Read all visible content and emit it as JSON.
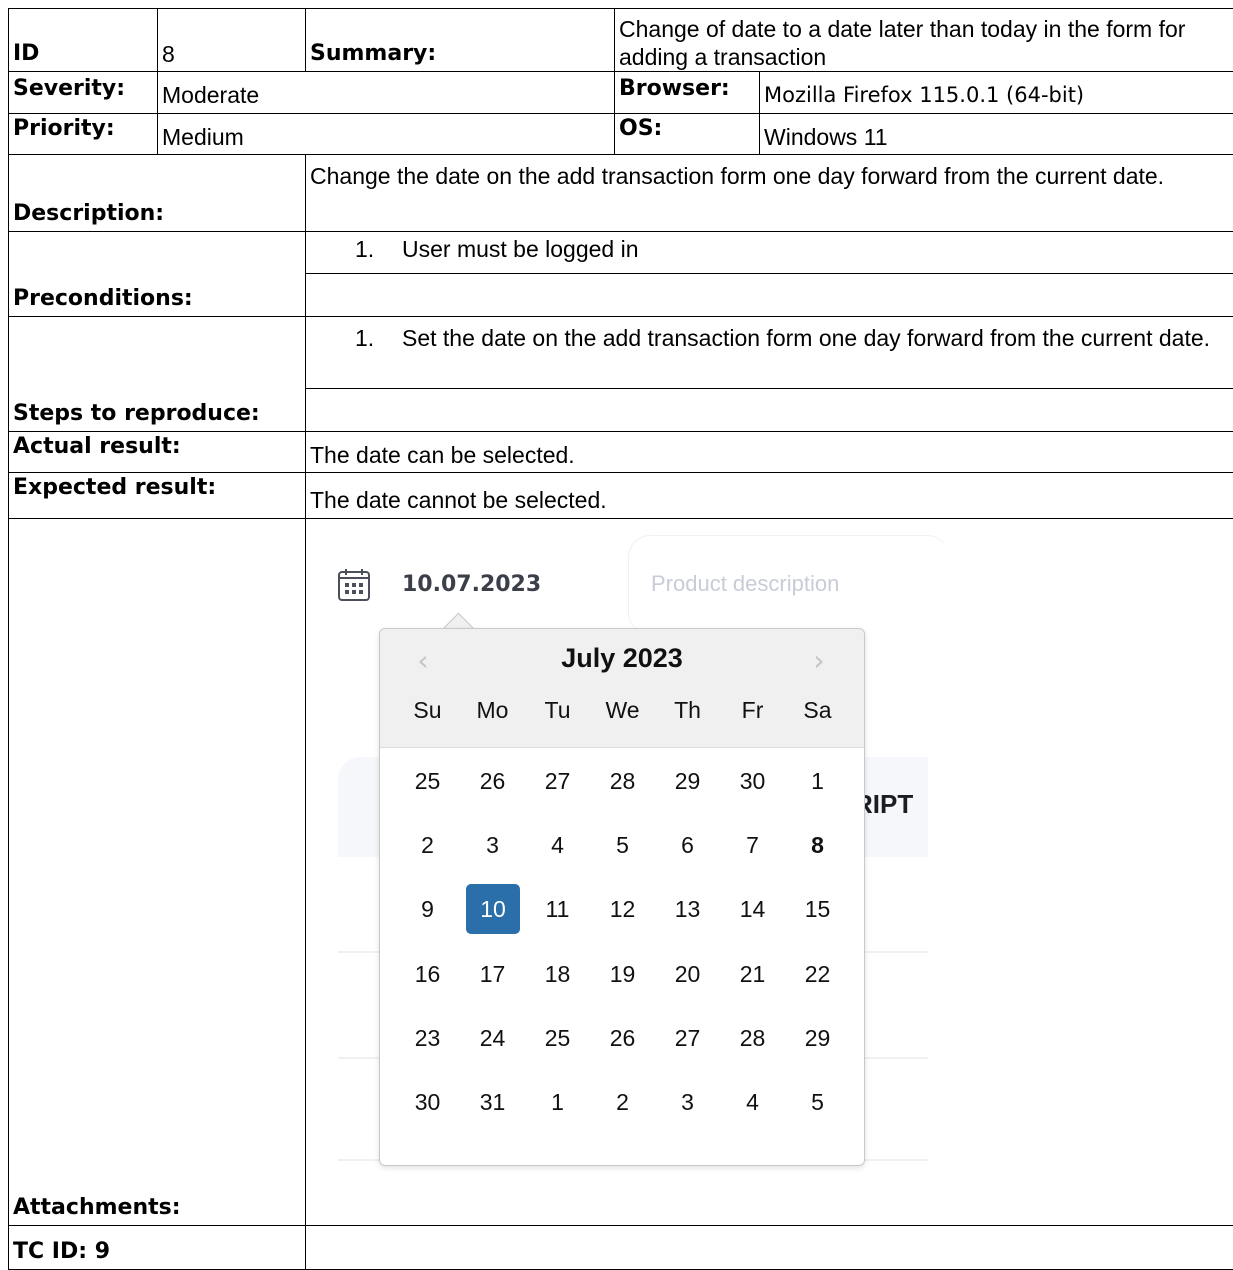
{
  "report": {
    "id_label": "ID",
    "id_value": "8",
    "summary_label": "Summary:",
    "summary_value": "Change of date to a date later than today in the form for adding a transaction",
    "severity_label": "Severity:",
    "severity_value": "Moderate",
    "browser_label": "Browser:",
    "browser_value": "Mozilla Firefox 115.0.1 (64-bit)",
    "priority_label": "Priority:",
    "priority_value": "Medium",
    "os_label": "OS:",
    "os_value": "Windows 11",
    "description_label": "Description:",
    "description_value": "Change the date on the add transaction form one day forward from the current date.",
    "preconditions_label": "Preconditions:",
    "preconditions": [
      {
        "num": "1.",
        "text": "User must be logged in"
      }
    ],
    "steps_label": "Steps to reproduce:",
    "steps": [
      {
        "num": "1.",
        "text": "Set the date on the add transaction form one day forward from the current date."
      }
    ],
    "actual_label": "Actual result:",
    "actual_value": "The date can be selected.",
    "expected_label": "Expected result:",
    "expected_value": "The date cannot be selected.",
    "attachments_label": "Attachments:",
    "next_tc_label": "TC ID: 9"
  },
  "attachment": {
    "selected_date": "10.07.2023",
    "placeholder": "Product description",
    "ghost_heading_fragment": "RIPT",
    "calendar_icon": "calendar-icon",
    "picker": {
      "prev_icon": "chevron-left-icon",
      "next_icon": "chevron-right-icon",
      "prev_glyph": "‹",
      "next_glyph": "›",
      "month_title": "July 2023",
      "weekdays": [
        "Su",
        "Mo",
        "Tu",
        "We",
        "Th",
        "Fr",
        "Sa"
      ],
      "weeks": [
        [
          "25",
          "26",
          "27",
          "28",
          "29",
          "30",
          "1"
        ],
        [
          "2",
          "3",
          "4",
          "5",
          "6",
          "7",
          "8"
        ],
        [
          "9",
          "10",
          "11",
          "12",
          "13",
          "14",
          "15"
        ],
        [
          "16",
          "17",
          "18",
          "19",
          "20",
          "21",
          "22"
        ],
        [
          "23",
          "24",
          "25",
          "26",
          "27",
          "28",
          "29"
        ],
        [
          "30",
          "31",
          "1",
          "2",
          "3",
          "4",
          "5"
        ]
      ],
      "selected_day": "10",
      "bold_day": "8",
      "selected_color": "#2a6faa"
    }
  }
}
